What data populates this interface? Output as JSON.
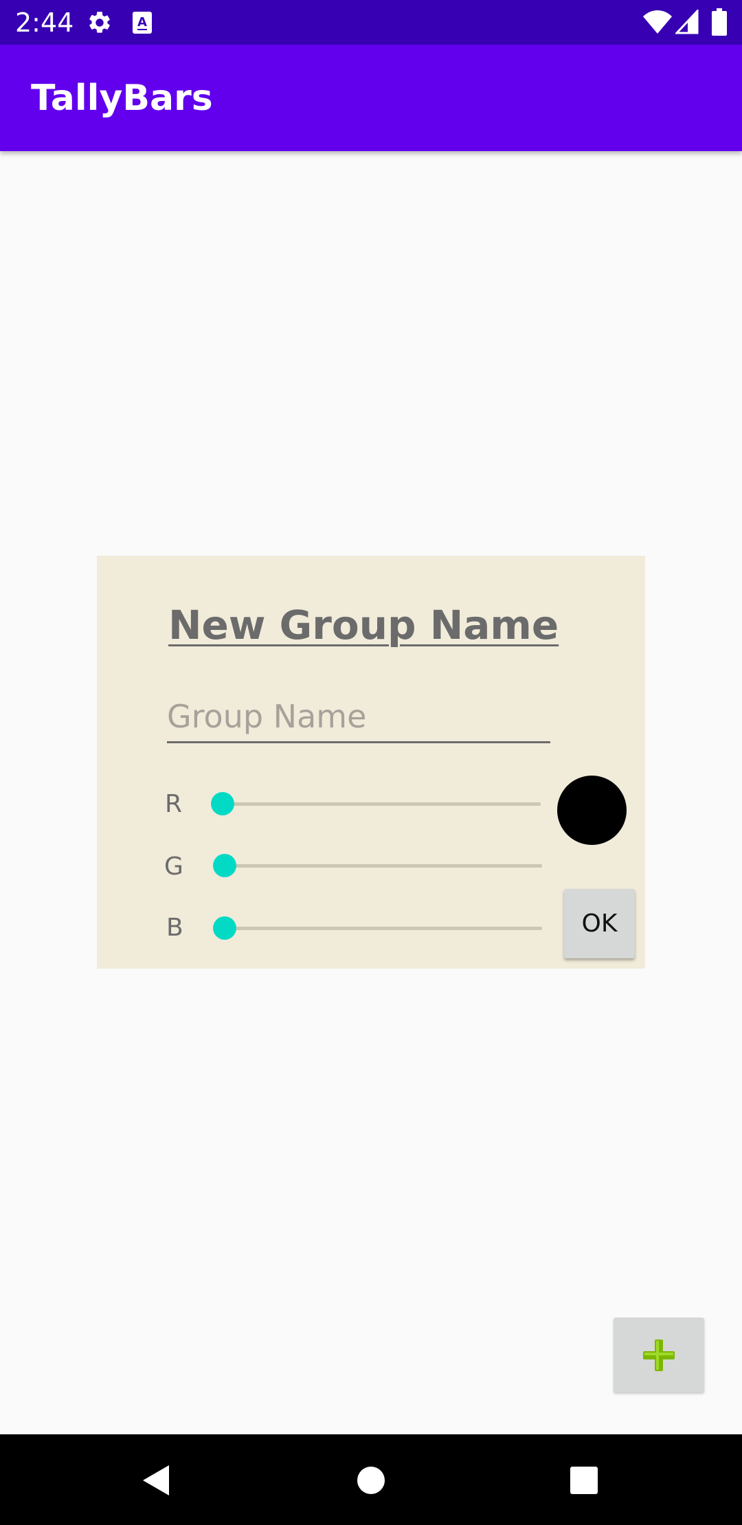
{
  "status_bar": {
    "time": "2:44",
    "icons": [
      "settings-icon",
      "keyboard-a-icon",
      "wifi-icon",
      "signal-icon",
      "battery-icon"
    ]
  },
  "app_bar": {
    "title": "TallyBars",
    "color": "#6200ee"
  },
  "dialog": {
    "title": "New Group Name",
    "input_placeholder": "Group Name",
    "input_value": "",
    "sliders": [
      {
        "label": "R",
        "value": 0
      },
      {
        "label": "G",
        "value": 0
      },
      {
        "label": "B",
        "value": 0
      }
    ],
    "preview_color": "#000000",
    "ok_label": "OK",
    "background": "#f1ebda"
  },
  "fab": {
    "icon": "plus-icon"
  },
  "nav_bar": {
    "buttons": [
      "back-icon",
      "home-icon",
      "recents-icon"
    ]
  },
  "colors": {
    "accent": "#03dac5",
    "status_bar": "#3700b3",
    "add_icon": "#7cb700"
  }
}
